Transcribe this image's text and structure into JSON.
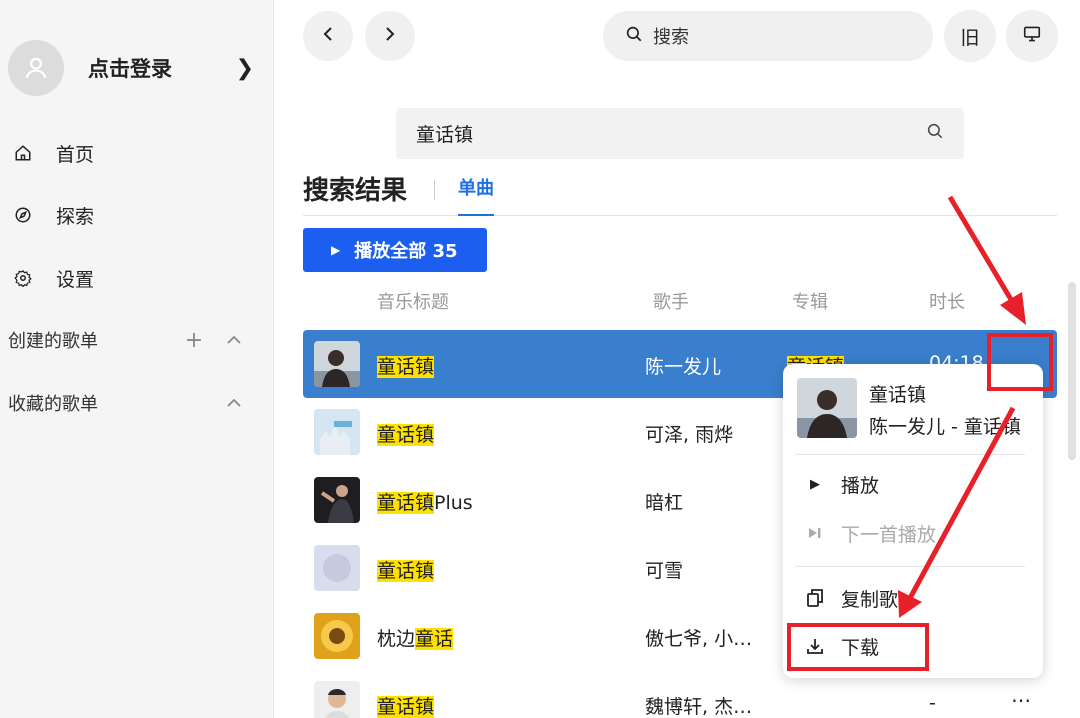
{
  "sidebar": {
    "login_label": "点击登录",
    "nav": [
      {
        "label": "首页",
        "icon": "home-icon"
      },
      {
        "label": "探索",
        "icon": "compass-icon"
      },
      {
        "label": "设置",
        "icon": "gear-icon"
      }
    ],
    "created_playlists": "创建的歌单",
    "collected_playlists": "收藏的歌单"
  },
  "topbar": {
    "search_placeholder": "搜索",
    "old_ui_label": "旧"
  },
  "search": {
    "query": "童话镇",
    "results_title": "搜索结果",
    "tab_label": "单曲",
    "play_all_label": "播放全部 35"
  },
  "columns": {
    "title": "音乐标题",
    "artist": "歌手",
    "album": "专辑",
    "duration": "时长"
  },
  "rows": [
    {
      "title_hl": "童话镇",
      "title_rest": "",
      "artist": "陈一发儿",
      "album": "童话镇",
      "duration": "04:18",
      "selected": true
    },
    {
      "title_hl": "童话镇",
      "title_rest": "",
      "artist": "可泽, 雨烨"
    },
    {
      "title_hl": "童话镇",
      "title_rest": "Plus",
      "artist": "暗杠"
    },
    {
      "title_hl": "童话镇",
      "title_rest": "",
      "artist": "可雪"
    },
    {
      "title_pre": "枕边",
      "title_hl": "童话",
      "artist": "傲七爷, 小…"
    },
    {
      "title_hl": "童话镇",
      "title_rest": "",
      "artist": "魏博轩, 杰…",
      "duration": "-"
    }
  ],
  "context_menu": {
    "song_title": "童话镇",
    "song_sub": "陈一发儿 - 童话镇",
    "play": "播放",
    "play_next": "下一首播放",
    "copy": "复制歌",
    "download": "下载"
  },
  "colors": {
    "accent": "#1c5ff0",
    "selected_row": "#3a7fce",
    "highlight": "#ffe100",
    "annotation": "#e8202a"
  }
}
